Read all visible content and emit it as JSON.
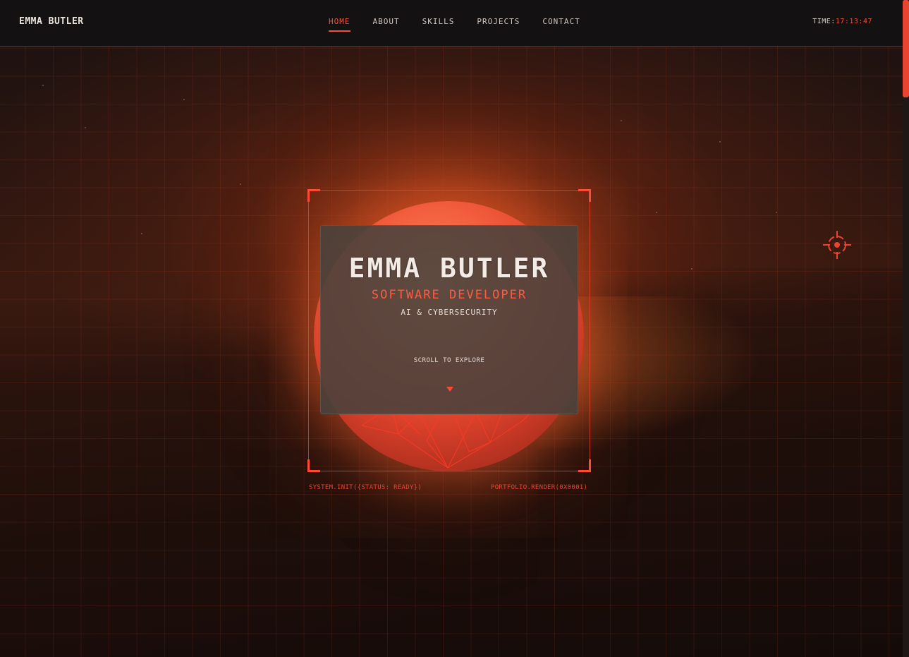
{
  "header": {
    "logo": "EMMA BUTLER",
    "nav": [
      {
        "label": "HOME",
        "active": true
      },
      {
        "label": "ABOUT",
        "active": false
      },
      {
        "label": "SKILLS",
        "active": false
      },
      {
        "label": "PROJECTS",
        "active": false
      },
      {
        "label": "CONTACT",
        "active": false
      }
    ],
    "clock_label": "TIME:",
    "clock_value": "17:13:47"
  },
  "hero": {
    "name": "EMMA BUTLER",
    "role": "SOFTWARE DEVELOPER",
    "subtitle": "AI & CYBERSECURITY",
    "scroll_label": "SCROLL TO EXPLORE"
  },
  "code": {
    "left": "SYSTEM.INIT({STATUS: READY})",
    "right": "PORTFOLIO.RENDER(0X0001)"
  },
  "icons": {
    "target": "crosshair-icon",
    "scroll": "triangle-down-icon"
  },
  "colors": {
    "accent": "#f0503a",
    "header_bg": "#131111",
    "card_bg": "#48423c"
  }
}
